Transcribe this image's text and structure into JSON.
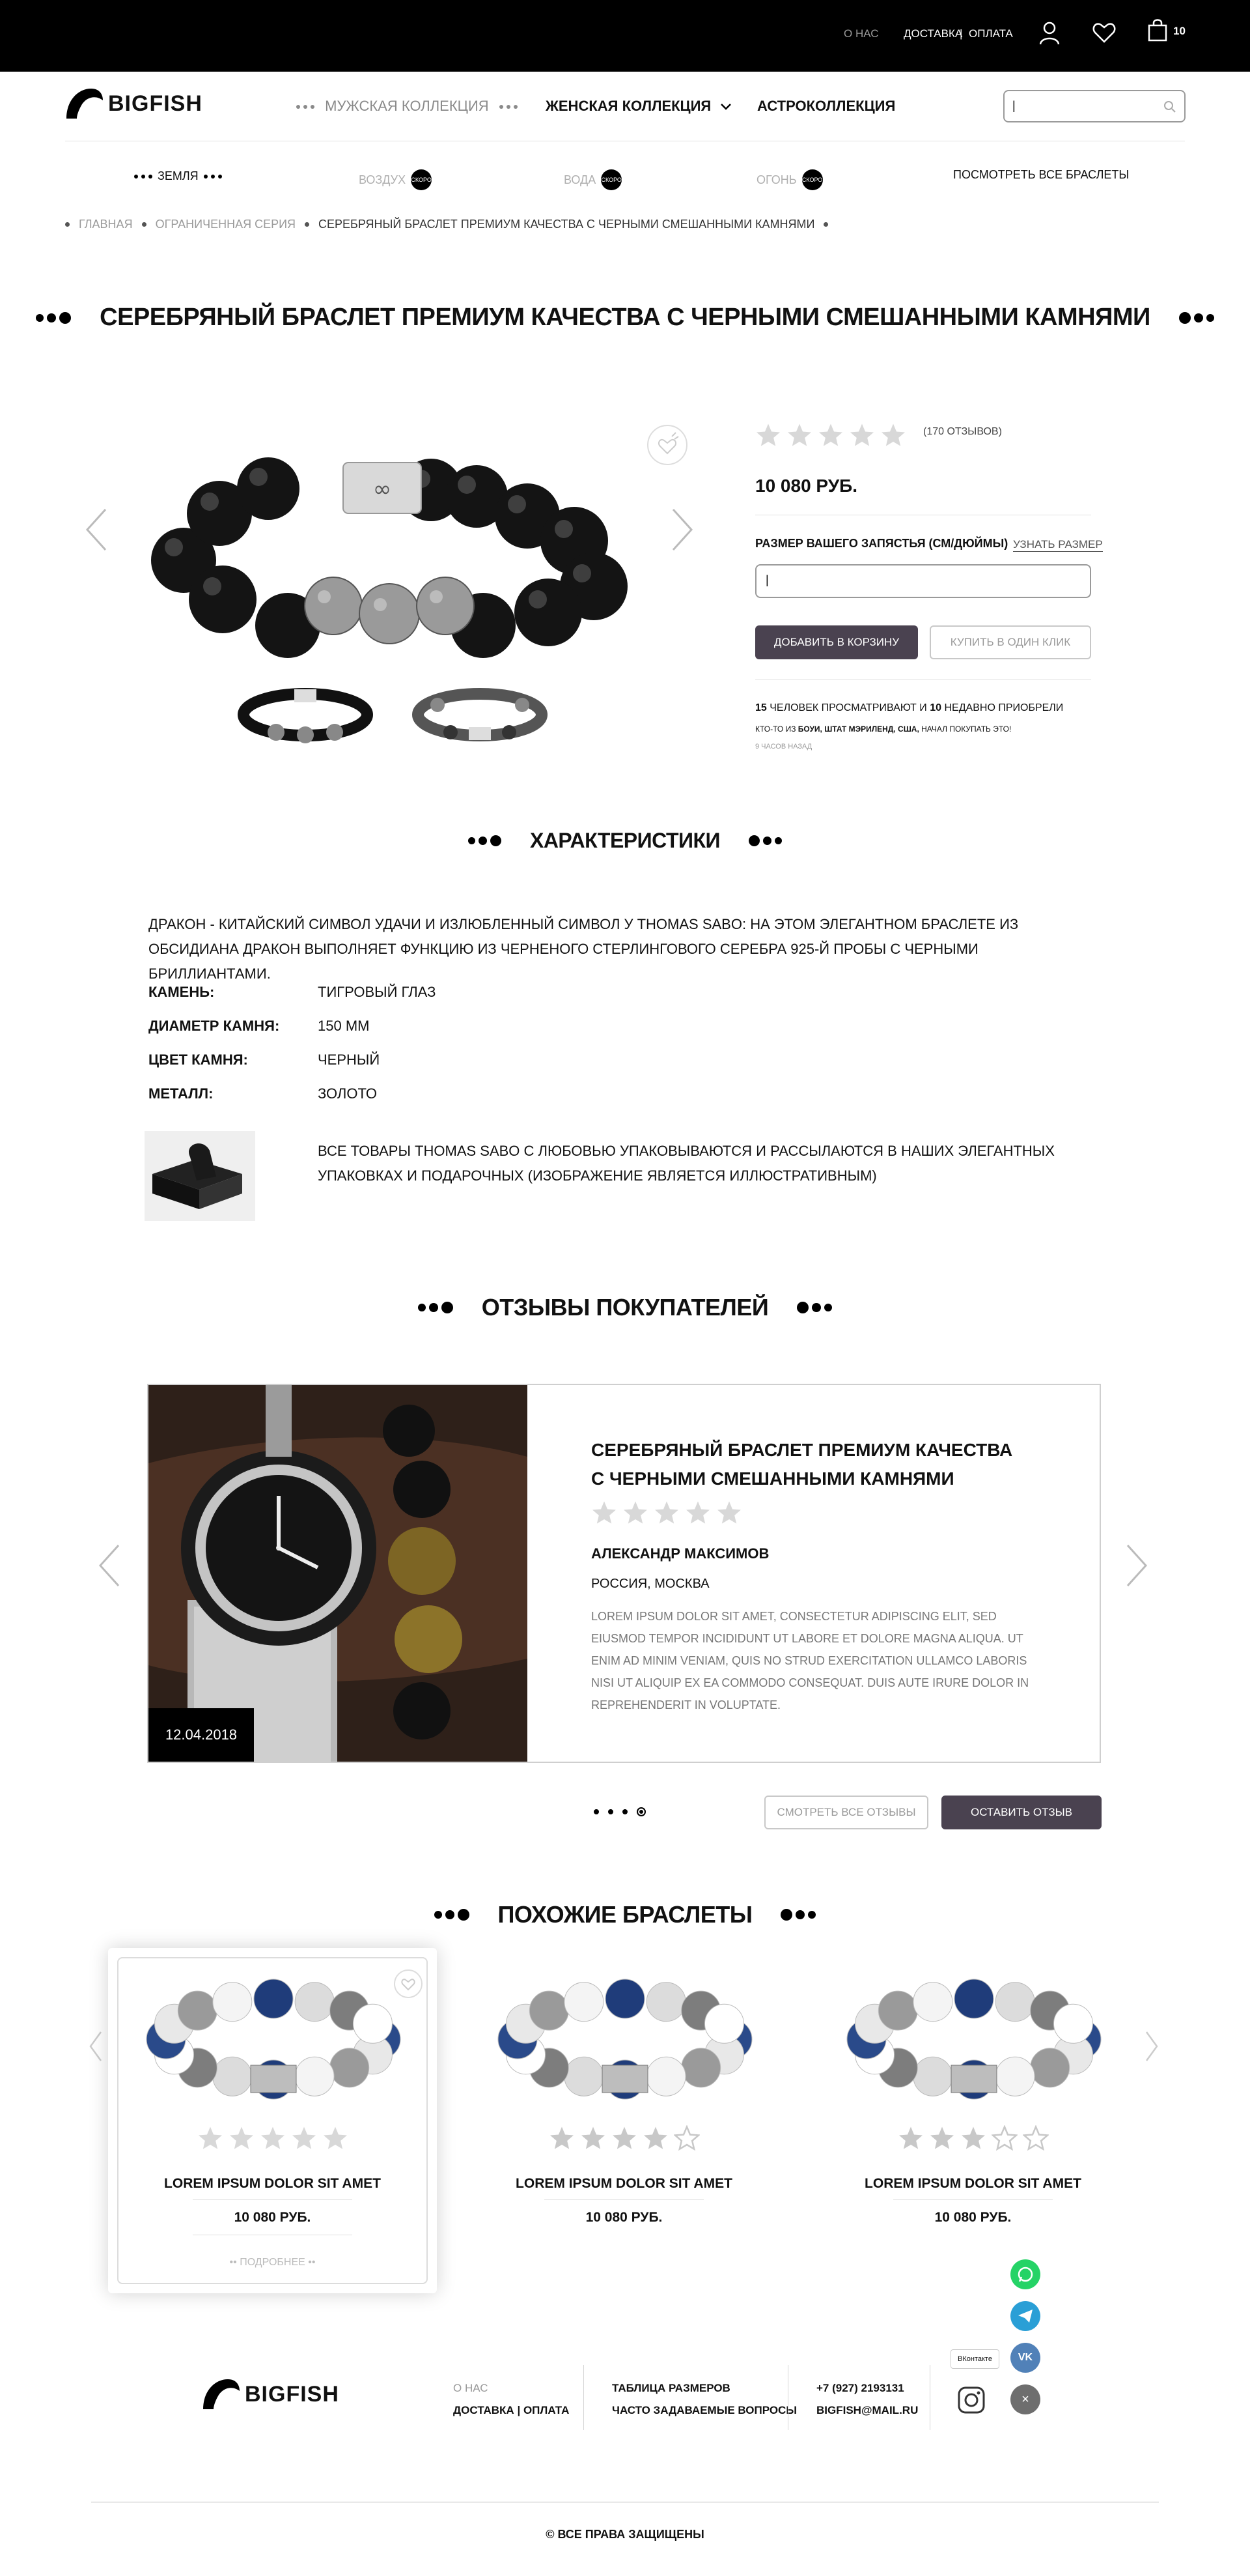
{
  "topbar": {
    "about": "О НАС",
    "delivery": "ДОСТАВКА",
    "sep": "|",
    "payment": "ОПЛАТА",
    "cart_count": "10"
  },
  "header": {
    "logo_text": "BIGFISH",
    "nav": {
      "men": "МУЖСКАЯ КОЛЛЕКЦИЯ",
      "women": "ЖЕНСКАЯ КОЛЛЕКЦИЯ",
      "astro": "АСТРОКОЛЛЕКЦИЯ"
    },
    "search_value": "|"
  },
  "elements": {
    "earth": "ЗЕМЛЯ",
    "air": "ВОЗДУХ",
    "water": "ВОДА",
    "fire": "ОГОНЬ",
    "badge": "СКОРО",
    "all": "ПОСМОТРЕТЬ ВСЕ БРАСЛЕТЫ"
  },
  "breadcrumb": {
    "home": "ГЛАВНАЯ",
    "series": "ОГРАНИЧЕННАЯ СЕРИЯ",
    "current": "СЕРЕБРЯНЫЙ БРАСЛЕТ ПРЕМИУМ КАЧЕСТВА С ЧЕРНЫМИ СМЕШАННЫМИ КАМНЯМИ"
  },
  "product": {
    "title": "СЕРЕБРЯНЫЙ БРАСЛЕТ ПРЕМИУМ КАЧЕСТВА С ЧЕРНЫМИ СМЕШАННЫМИ КАМНЯМИ",
    "reviews": "(170 ОТЗЫВОВ)",
    "rating": 0,
    "price": "10 080 РУБ.",
    "size_label": "РАЗМЕР ВАШЕГО ЗАПЯСТЬЯ (СМ/ДЮЙМЫ)",
    "size_link": "УЗНАТЬ РАЗМЕР",
    "size_value": "|",
    "add_to_cart": "ДОБАВИТЬ В КОРЗИНУ",
    "one_click": "КУПИТЬ В ОДИН КЛИК",
    "viewing_count": "15",
    "viewing_text": "ЧЕЛОВЕК ПРОСМАТРИВАЮТ И",
    "bought_count": "10",
    "bought_text": "НЕДАВНО ПРИОБРЕЛИ",
    "recent_prefix": "КТО-ТО ИЗ",
    "recent_place": "БОУИ, ШТАТ МЭРИЛЕНД, США,",
    "recent_suffix": "НАЧАЛ ПОКУПАТЬ ЭТО!",
    "recent_time": "9 ЧАСОВ НАЗАД"
  },
  "specs": {
    "title": "ХАРАКТЕРИСТИКИ",
    "description": "ДРАКОН - КИТАЙСКИЙ СИМВОЛ УДАЧИ И ИЗЛЮБЛЕННЫЙ СИМВОЛ У THOMAS SABO: НА ЭТОМ ЭЛЕГАНТНОМ БРАСЛЕТЕ ИЗ ОБСИДИАНА ДРАКОН ВЫПОЛНЯЕТ ФУНКЦИЮ ИЗ ЧЕРНЕНОГО СТЕРЛИНГОВОГО СЕРЕБРА 925-Й ПРОБЫ С ЧЕРНЫМИ БРИЛЛИАНТАМИ.",
    "rows": [
      {
        "k": "КАМЕНЬ:",
        "v": "ТИГРОВЫЙ ГЛАЗ"
      },
      {
        "k": "ДИАМЕТР КАМНЯ:",
        "v": "150 ММ"
      },
      {
        "k": "ЦВЕТ КАМНЯ:",
        "v": "ЧЕРНЫЙ"
      },
      {
        "k": "МЕТАЛЛ:",
        "v": "ЗОЛОТО"
      }
    ],
    "packaging": "ВСЕ ТОВАРЫ THOMAS SABO С ЛЮБОВЬЮ УПАКОВЫВАЮТСЯ И РАССЫЛАЮТСЯ В НАШИХ ЭЛЕГАНТНЫХ УПАКОВКАХ И ПОДАРОЧНЫХ (ИЗОБРАЖЕНИЕ ЯВЛЯЕТСЯ ИЛЛЮСТРАТИВНЫМ)"
  },
  "reviews": {
    "title": "ОТЗЫВЫ ПОКУПАТЕЛЕЙ",
    "date": "12.04.2018",
    "product_line1": "СЕРЕБРЯНЫЙ БРАСЛЕТ ПРЕМИУМ КАЧЕСТВА",
    "product_line2": "С ЧЕРНЫМИ СМЕШАННЫМИ КАМНЯМИ",
    "rating": 0,
    "author": "АЛЕКСАНДР МАКСИМОВ",
    "location": "РОССИЯ, МОСКВА",
    "text": "LOREM IPSUM DOLOR SIT AMET, CONSECTETUR ADIPISCING ELIT, SED EIUSMOD TEMPOR INCIDIDUNT UT LABORE ET DOLORE MAGNA ALIQUA. UT ENIM AD MINIM VENIAM, QUIS NO STRUD EXERCITATION ULLAMCO LABORIS NISI UT ALIQUIP EX EA COMMODO CONSEQUAT. DUIS AUTE IRURE DOLOR IN REPREHENDERIT IN VOLUPTATE.",
    "pages": 4,
    "active_page": 4,
    "see_all": "СМОТРЕТЬ ВСЕ ОТЗЫВЫ",
    "leave": "ОСТАВИТЬ ОТЗЫВ"
  },
  "similar": {
    "title": "ПОХОЖИЕ БРАСЛЕТЫ",
    "more": "ПОДРОБНЕЕ",
    "items": [
      {
        "name": "LOREM IPSUM DOLOR SIT AMET",
        "price": "10 080 РУБ.",
        "rating": 0
      },
      {
        "name": "LOREM IPSUM DOLOR SIT AMET",
        "price": "10 080 РУБ.",
        "rating": 4
      },
      {
        "name": "LOREM IPSUM DOLOR SIT AMET",
        "price": "10 080 РУБ.",
        "rating": 3
      }
    ]
  },
  "footer": {
    "logo_text": "BIGFISH",
    "about": "О НАС",
    "delivery": "ДОСТАВКА",
    "sep": "|",
    "payment": "ОПЛАТА",
    "sizes": "ТАБЛИЦА РАЗМЕРОВ",
    "faq": "ЧАСТО ЗАДАВАЕМЫЕ ВОПРОСЫ",
    "phone": "+7 (927) 2193131",
    "email": "BIGFISH@MAIL.RU",
    "vk_tooltip": "ВКонтакте",
    "copyright": "© ВСЕ ПРАВА ЗАЩИЩЕНЫ"
  },
  "colors": {
    "accent_button": "#4a4250",
    "whatsapp": "#25d366",
    "telegram": "#2a9fd6",
    "vk": "#5181b8"
  }
}
